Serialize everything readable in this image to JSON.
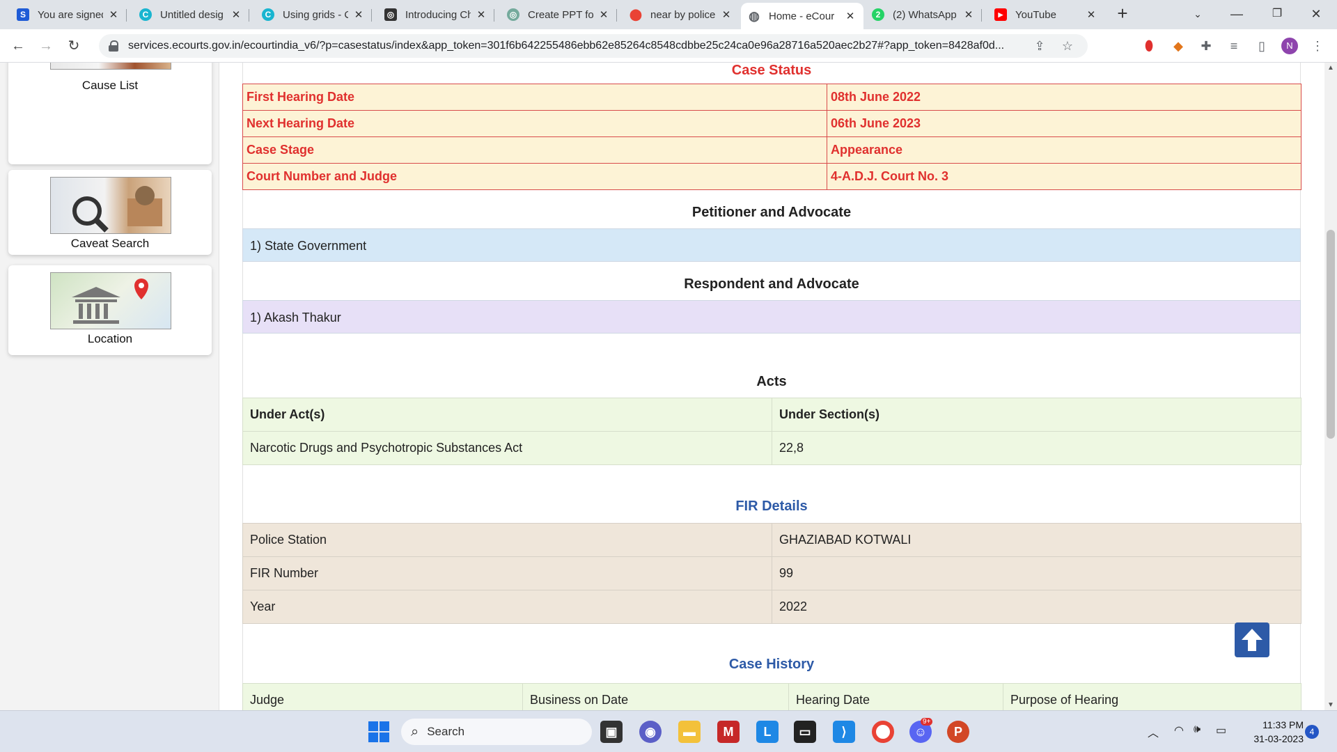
{
  "browser": {
    "tabs": [
      {
        "title": "You are signed",
        "favicon_color": "#1e5bd6",
        "favicon_glyph": "S"
      },
      {
        "title": "Untitled desig",
        "favicon_color": "#19b5d0",
        "favicon_glyph": "C"
      },
      {
        "title": "Using grids - C",
        "favicon_color": "#19b5d0",
        "favicon_glyph": "C"
      },
      {
        "title": "Introducing Ch",
        "favicon_color": "#333333",
        "favicon_glyph": "◎"
      },
      {
        "title": "Create PPT for",
        "favicon_color": "#74aa9c",
        "favicon_glyph": "◎"
      },
      {
        "title": "near by police",
        "favicon_color": "#34a853",
        "favicon_glyph": "⬤"
      },
      {
        "title": "Home - eCour",
        "favicon_color": "#5f6368",
        "favicon_glyph": "◍"
      },
      {
        "title": "(2) WhatsApp",
        "favicon_color": "#25d366",
        "favicon_glyph": "2"
      },
      {
        "title": "YouTube",
        "favicon_color": "#ff0000",
        "favicon_glyph": "▶"
      }
    ],
    "url": "services.ecourts.gov.in/ecourtindia_v6/?p=casestatus/index&app_token=301f6b642255486ebb62e85264c8548cdbbe25c24ca0e96a28716a520aec2b27#?app_token=8428af0d...",
    "profile_initial": "N"
  },
  "sidebar": {
    "items": [
      {
        "label": "Cause List"
      },
      {
        "label": "Caveat Search"
      },
      {
        "label": "Location"
      }
    ]
  },
  "case_status": {
    "title": "Case Status",
    "rows": [
      {
        "label": "First Hearing Date",
        "value": "08th June 2022"
      },
      {
        "label": "Next Hearing Date",
        "value": "06th June 2023"
      },
      {
        "label": "Case Stage",
        "value": "Appearance"
      },
      {
        "label": "Court Number and Judge",
        "value": "4-A.D.J. Court No. 3"
      }
    ]
  },
  "petitioner": {
    "title": "Petitioner and Advocate",
    "entries": [
      "1) State Government"
    ]
  },
  "respondent": {
    "title": "Respondent and Advocate",
    "entries": [
      "1) Akash Thakur"
    ]
  },
  "acts": {
    "title": "Acts",
    "headers": [
      "Under Act(s)",
      "Under Section(s)"
    ],
    "rows": [
      [
        "Narcotic Drugs and Psychotropic Substances Act",
        "22,8"
      ]
    ]
  },
  "fir": {
    "title": "FIR Details",
    "rows": [
      [
        "Police Station",
        "GHAZIABAD KOTWALI"
      ],
      [
        "FIR Number",
        "99"
      ],
      [
        "Year",
        "2022"
      ]
    ]
  },
  "case_history": {
    "title": "Case History",
    "headers": [
      "Judge",
      "Business on Date",
      "Hearing Date",
      "Purpose of Hearing"
    ]
  },
  "taskbar": {
    "search_label": "Search",
    "time": "11:33 PM",
    "date": "31-03-2023",
    "notification_count": "4",
    "discord_badge": "9+"
  },
  "colors": {
    "status_text": "#e0302e",
    "status_bg": "#fdf3d6",
    "petitioner_bg": "#d5e8f7",
    "respondent_bg": "#e7e0f7",
    "acts_bg": "#eef8e2",
    "fir_bg": "#efe6da",
    "accent_blue": "#2d5aa7"
  }
}
